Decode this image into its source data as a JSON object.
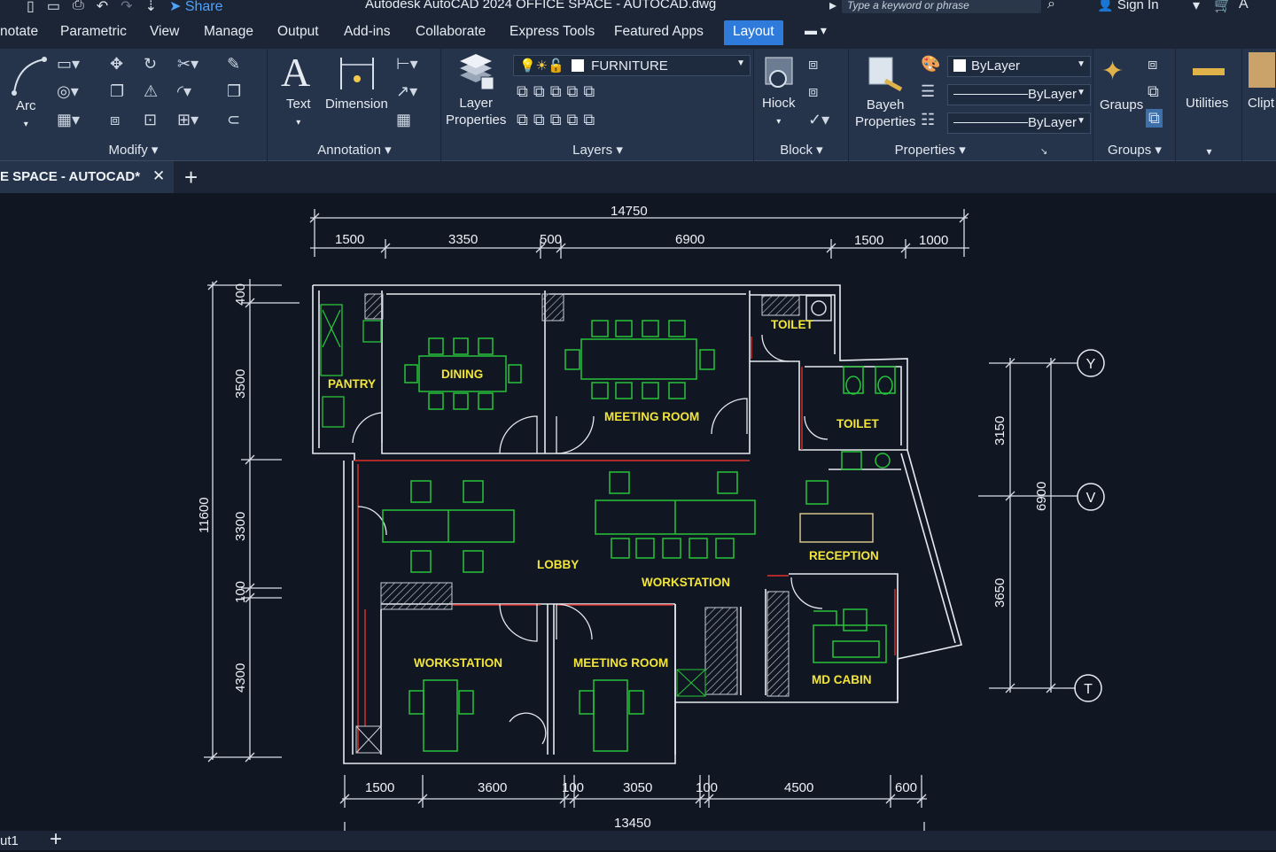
{
  "titlebar": {
    "share_label": "Share",
    "title": "Autodesk AutoCAD 2024    OFFICE SPACE - AUTOCAD.dwg",
    "search_placeholder": "Type a keyword or phrase",
    "sign_in": "Sign In"
  },
  "ribbon_tabs": [
    {
      "label": "notate"
    },
    {
      "label": "Parametric"
    },
    {
      "label": "View"
    },
    {
      "label": "Manage"
    },
    {
      "label": "Output"
    },
    {
      "label": "Add-ins"
    },
    {
      "label": "Collaborate"
    },
    {
      "label": "Express Tools"
    },
    {
      "label": "Featured Apps"
    },
    {
      "label": "Layout",
      "active": true
    }
  ],
  "ribbon": {
    "modify": {
      "arc_label": "Arc",
      "title": "Modify"
    },
    "annotation": {
      "text_label": "Text",
      "dimension_label": "Dimension",
      "title": "Annotation"
    },
    "layers": {
      "layer_properties_1": "Layer",
      "layer_properties_2": "Properties",
      "current_layer": "FURNITURE",
      "title": "Layers"
    },
    "block": {
      "insert_label": "Hiock",
      "title": "Block"
    },
    "properties": {
      "match_1": "Bayeh",
      "match_2": "Properties",
      "color": "ByLayer",
      "linetype": "ByLayer",
      "lineweight": "ByLayer",
      "title": "Properties"
    },
    "groups": {
      "label": "Graups",
      "title": "Groups"
    },
    "utilities": {
      "label": "Utilities"
    },
    "clipboard": {
      "label": "Clipt"
    }
  },
  "document": {
    "tab_title": "E SPACE - AUTOCAD*",
    "layout_tab": "ut1"
  },
  "drawing": {
    "top_dims": {
      "overall": "14750",
      "segments": [
        "1500",
        "3350",
        "500",
        "6900",
        "1500",
        "1000"
      ]
    },
    "left_dims": {
      "overall": "11600",
      "segments": [
        "400",
        "3500",
        "3300",
        "100",
        "4300"
      ]
    },
    "bottom_dims": {
      "overall": "13450",
      "segments": [
        "1500",
        "3600",
        "100",
        "3050",
        "100",
        "4500",
        "600"
      ]
    },
    "right_dims": {
      "overall": "6900",
      "segments": [
        "3150",
        "3650"
      ]
    },
    "grid_bubbles": [
      "Y",
      "V",
      "T"
    ],
    "rooms": {
      "pantry": "PANTRY",
      "dining": "DINING",
      "meeting_room_top": "MEETING ROOM",
      "toilet_1": "TOILET",
      "toilet_2": "TOILET",
      "lobby": "LOBBY",
      "workstation_center": "WORKSTATION",
      "reception": "RECEPTION",
      "workstation_bottom": "WORKSTATION",
      "meeting_room_bottom": "MEETING ROOM",
      "md_cabin": "MD CABIN"
    }
  },
  "colors": {
    "accent_tab": "#2e7bdc",
    "ribbon_bg": "#26344b",
    "canvas_bg": "#101723",
    "wall": "#e9edf3",
    "furniture": "#28c43a",
    "room_label": "#f3e53a",
    "red_line": "#e0312d"
  }
}
